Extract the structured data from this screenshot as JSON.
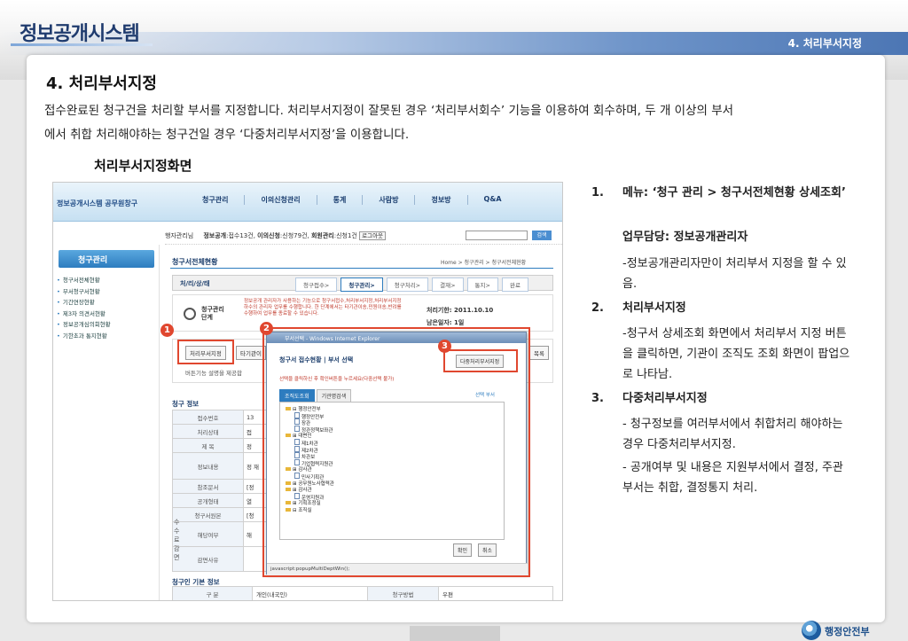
{
  "slide": {
    "system_title": "정보공개시스템",
    "section_tag": "4. 처리부서지정",
    "heading": "4. 처리부서지정",
    "intro_line1": "접수완료된 청구건을 처리할 부서를 지정합니다. 처리부서지정이 잘못된 경우 ‘처리부서회수’ 기능을 이용하여 회수하며, 두 개 이상의 부서",
    "intro_line2": "에서 취합 처리해야하는 청구건일 경우 ‘다중처리부서지정’을 이용합니다.",
    "subheading": "처리부서지정화면",
    "footer_logo_text": "행정안전부"
  },
  "screenshot": {
    "logo": "정보공개시스템 공무원창구",
    "topnav": [
      "청구관리",
      "이의신청관리",
      "통계",
      "사람방",
      "정보방",
      "Q&A"
    ],
    "userbar": {
      "user": "행자관리님",
      "info_label": "정보공개",
      "info_value": ":접수13건,",
      "objection_label": "이의신청",
      "objection_value": ":신청79건,",
      "admin_label": "회원관리",
      "admin_value": ":신청1건",
      "logout": "로그아웃",
      "search_btn": "검색"
    },
    "lnav": {
      "title": "청구관리",
      "items": [
        "청구서전체현황",
        "부서청구서현황",
        "기간연장현황",
        "제3자 의견서현황",
        "정보공개심의회현황",
        "기한초과 통지현황"
      ]
    },
    "crumb_title": "청구서전체현황",
    "crumb_path": "Home > 청구관리 > 청구서전체현황",
    "stepbar": {
      "label": "처/리/상/태",
      "steps": [
        "청구접수>",
        "청구관리>",
        "청구처리>",
        "결재>",
        "통지>",
        "완료"
      ]
    },
    "phase": {
      "name_line1": "청구관리",
      "name_line2": "단계",
      "desc": "정보공개 관리자가 사용하는 기능으로 청구서접수,처리부서지정,처리부서지정하수의 관리자 업무를 수행합니다. 한 단계에서는 타기관이송,민원이송,반려를 수행하여 업무를 종료할 수 있습니다.",
      "deadline": "처리기한: 2011.10.10",
      "remaining": "남은일자: 1일"
    },
    "btn_assign": "처리부서지정",
    "btn_transfer": "타기관이",
    "btn_list": "목록",
    "btn_note": "버튼기능 설명을 제공합",
    "claim_info_title": "청구 정보",
    "claim_rows": [
      {
        "k": "접수번호",
        "v": "13"
      },
      {
        "k": "처리상태",
        "v": "접"
      },
      {
        "k": "제 목",
        "v": "정"
      },
      {
        "k": "정보내용",
        "v": "정 재"
      },
      {
        "k": "참조문서",
        "v": "[정"
      },
      {
        "k": "공개형태",
        "v": "열"
      },
      {
        "k": "청구서원본",
        "v": "[청"
      },
      {
        "k": "해당여부",
        "v": "해"
      },
      {
        "k": "감면사유",
        "v": ""
      }
    ],
    "side_label": "수수료감면",
    "requester_title": "청구인 기본 정보",
    "bottom_row": {
      "k1": "구 분",
      "v1": "개인(내국인)",
      "k2": "청구방법",
      "v2": "우편"
    }
  },
  "popup": {
    "window_title": "부서선택 - Windows Internet Explorer",
    "head": "청구서 접수현황 | 부서 선택",
    "assign_multi_btn": "다중처리부서지정",
    "note": "선택을 클릭하신 후 확인버튼을 누르세요(다중선택 불가)",
    "tabs": [
      "조직도조회",
      "기관명검색"
    ],
    "select_link": "선택 부서",
    "tree": [
      {
        "t": "f",
        "label": "⊟ 행정안전부"
      },
      {
        "t": "d",
        "label": "행정안전부"
      },
      {
        "t": "d",
        "label": "장관"
      },
      {
        "t": "d",
        "label": "정관정책보좌관"
      },
      {
        "t": "f",
        "label": "⊞ 대변인"
      },
      {
        "t": "d",
        "label": "제1차관"
      },
      {
        "t": "d",
        "label": "제2차관"
      },
      {
        "t": "d",
        "label": "차관보"
      },
      {
        "t": "d",
        "label": "기업협력지원관"
      },
      {
        "t": "f",
        "label": "⊞ 감사관"
      },
      {
        "t": "d",
        "label": "민사기획관"
      },
      {
        "t": "f",
        "label": "⊞ 공무원노사협력관"
      },
      {
        "t": "f",
        "label": "⊞ 감사관"
      },
      {
        "t": "d",
        "label": "운영지원과"
      },
      {
        "t": "f",
        "label": "⊞ 기획조정실"
      },
      {
        "t": "f",
        "label": "⊟ 조직실"
      }
    ],
    "ok": "확인",
    "cancel": "취소",
    "status": "javascript:popupMultiDeptWin();"
  },
  "badges": [
    "1",
    "2",
    "3"
  ],
  "explanation": {
    "item1_num": "1.",
    "item1_title": "메뉴: ‘청구 관리 > 청구서전체현황 상세조회’",
    "item1_owner": "업무담당: 정보공개관리자",
    "item1_note": "-정보공개관리자만이 처리부서 지정을 할 수 있음.",
    "item2_num": "2.",
    "item2_title": "처리부서지정",
    "item2_text": " -청구서 상세조회 화면에서 처리부서 지정 버튼을 클릭하면, 기관이 조직도 조회 화면이 팝업으로 나타남.",
    "item3_num": "3.",
    "item3_title": "다중처리부서지정",
    "item3_text1": "- 청구정보를 여러부서에서 취합처리 해야하는 경우 다중처리부서지정.",
    "item3_text2": "- 공개여부 및 내용은 지원부서에서 결정, 주관부서는 취합, 결정통지 처리."
  },
  "colors": {
    "accent": "#e0472f",
    "brand": "#1f3b6e",
    "link_blue": "#2d7cbf"
  }
}
